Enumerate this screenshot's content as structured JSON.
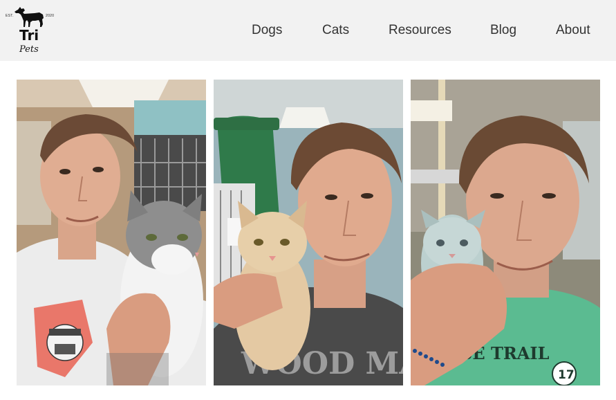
{
  "logo": {
    "est": "EST.",
    "year": "2020",
    "brand": "Tri",
    "tagline": "Pets"
  },
  "nav": {
    "items": [
      {
        "label": "Dogs"
      },
      {
        "label": "Cats"
      },
      {
        "label": "Resources"
      },
      {
        "label": "Blog"
      },
      {
        "label": "About"
      }
    ]
  },
  "gallery": {
    "photos": [
      {
        "shirt_text": ""
      },
      {
        "shirt_text": "WOOD MA"
      },
      {
        "shirt_text": "SE TRAIL",
        "shirt_number": "17"
      }
    ]
  },
  "colors": {
    "header_bg": "#f2f2f2",
    "nav_text": "#333333"
  }
}
